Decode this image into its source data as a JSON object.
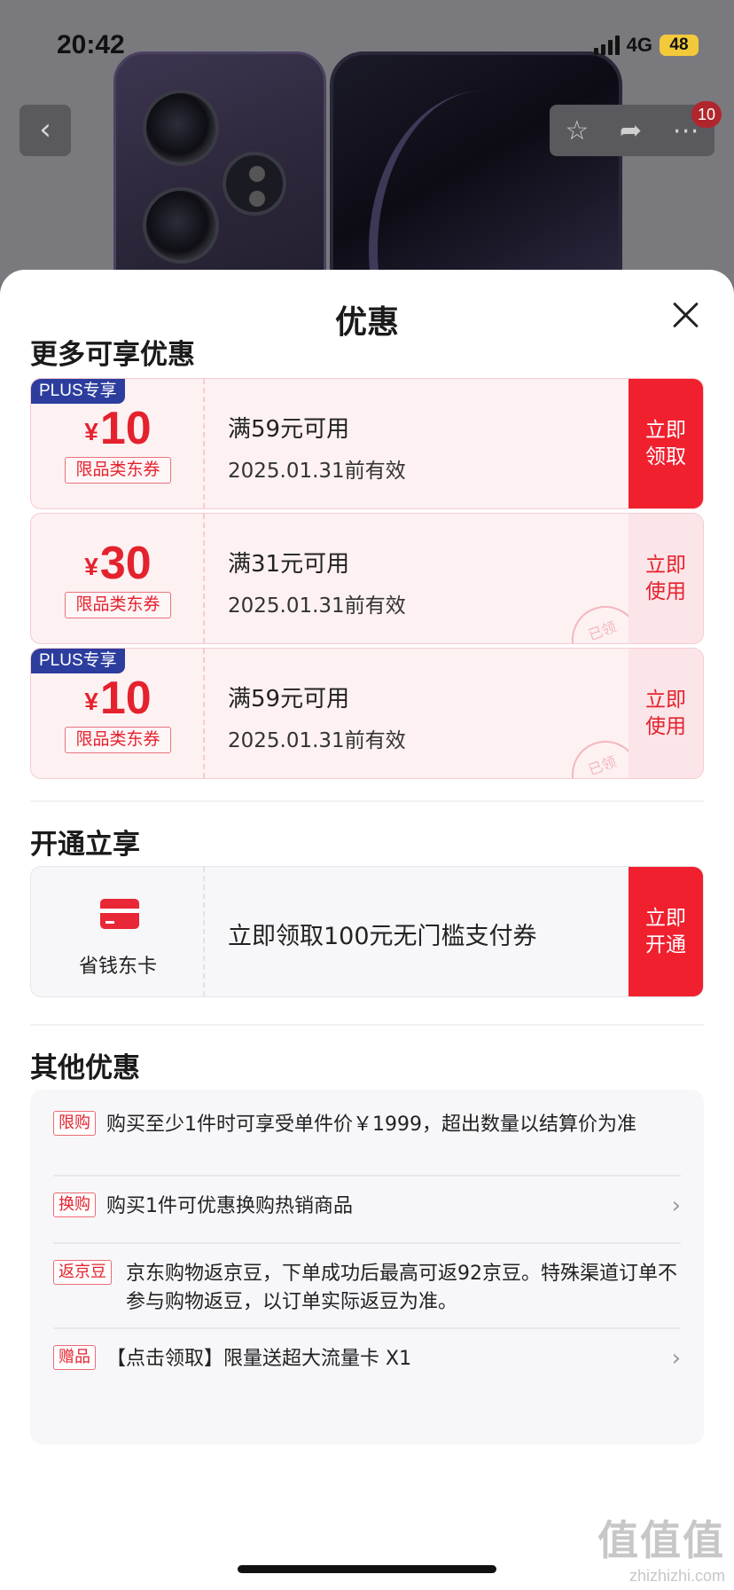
{
  "status_bar": {
    "time": "20:42",
    "network": "4G",
    "battery": "48"
  },
  "nav": {
    "back_icon": "chevron-left-icon",
    "favorite_icon": "star-icon",
    "share_icon": "share-icon",
    "more_icon": "more-icon",
    "badge_count": "10"
  },
  "sheet": {
    "title": "优惠"
  },
  "more_offers": {
    "title": "更多可享优惠",
    "coupons": [
      {
        "plus_label": "PLUS专享",
        "currency": "¥",
        "amount": "10",
        "tag": "限品类东券",
        "condition": "满59元可用",
        "valid": "2025.01.31前有效",
        "action": "立即\n领取"
      },
      {
        "plus_label": "",
        "currency": "¥",
        "amount": "30",
        "tag": "限品类东券",
        "condition": "满31元可用",
        "valid": "2025.01.31前有效",
        "action": "立即\n使用",
        "stamp": "已领"
      },
      {
        "plus_label": "PLUS专享",
        "currency": "¥",
        "amount": "10",
        "tag": "限品类东券",
        "condition": "满59元可用",
        "valid": "2025.01.31前有效",
        "action": "立即\n使用",
        "stamp": "已领"
      }
    ]
  },
  "open_section": {
    "title": "开通立享",
    "card_name": "省钱东卡",
    "description": "立即领取100元无门槛支付券",
    "action": "立即\n开通"
  },
  "other_offers": {
    "title": "其他优惠",
    "rows": [
      {
        "label": "限购",
        "text": "购买至少1件时可享受单件价￥1999，超出数量以结算价为准"
      },
      {
        "label": "换购",
        "text": "购买1件可优惠换购热销商品"
      },
      {
        "label": "返京豆",
        "text": "京东购物返京豆，下单成功后最高可返92京豆。特殊渠道订单不参与购物返豆，以订单实际返豆为准。"
      },
      {
        "label": "赠品",
        "text": "【点击领取】限量送超大流量卡 X1"
      }
    ]
  },
  "watermark": {
    "main": "值值值",
    "sub": "zhizhizhi.com"
  },
  "colors": {
    "accent": "#f0202f",
    "plus": "#2c3d9e"
  }
}
